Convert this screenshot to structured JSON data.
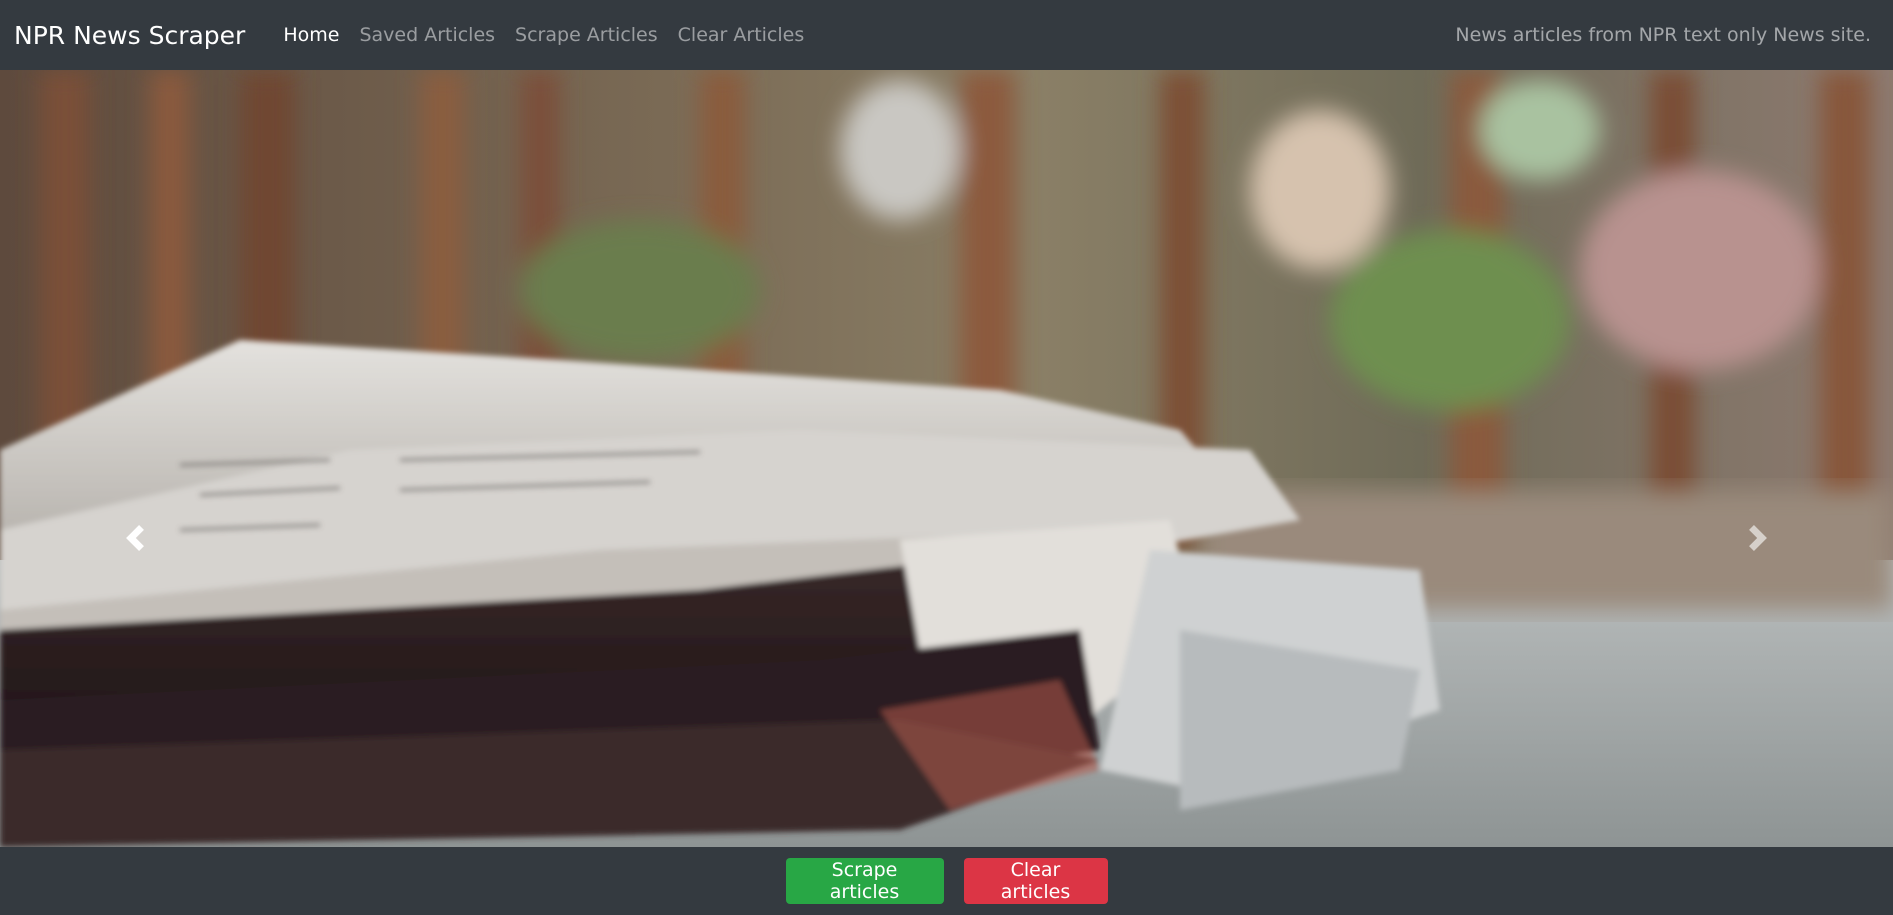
{
  "navbar": {
    "brand": "NPR News Scraper",
    "links": [
      {
        "label": "Home",
        "active": true
      },
      {
        "label": "Saved Articles",
        "active": false
      },
      {
        "label": "Scrape Articles",
        "active": false
      },
      {
        "label": "Clear Articles",
        "active": false
      }
    ],
    "tagline": "News articles from NPR text only News site."
  },
  "carousel": {
    "prev_icon": "chevron-left-icon",
    "next_icon": "chevron-right-icon"
  },
  "actions": {
    "scrape_label": "Scrape articles",
    "clear_label": "Clear articles"
  },
  "colors": {
    "navbar_bg": "#343a40",
    "success": "#28a745",
    "danger": "#dc3545"
  }
}
